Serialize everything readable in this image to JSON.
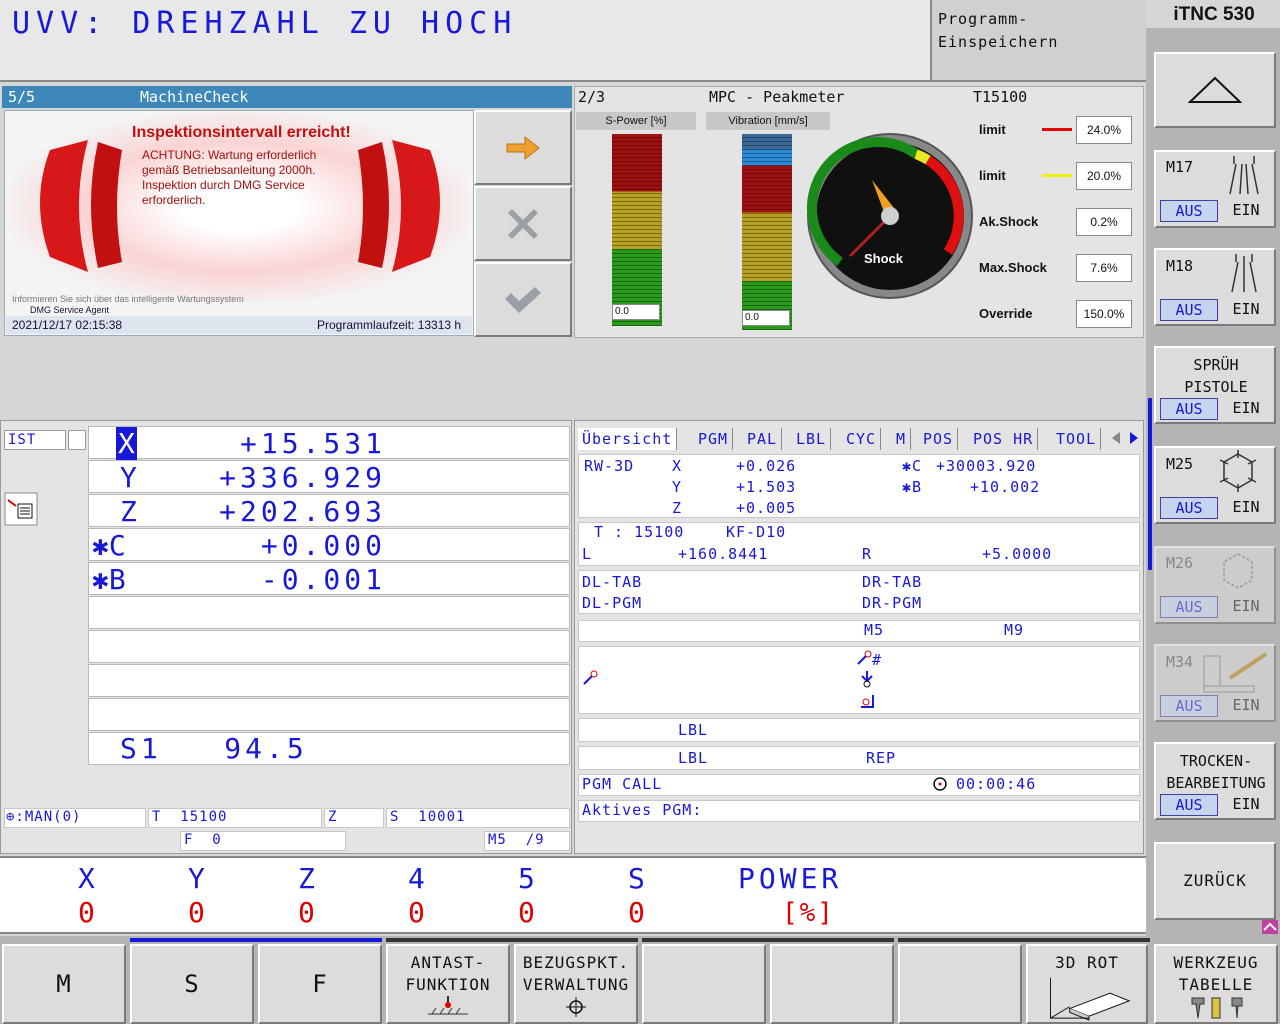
{
  "header": {
    "message": "UVV: DREHZAHL ZU HOCH",
    "mode_label": "Programm-\nEinspeichern",
    "brand": "iTNC 530"
  },
  "machinecheck": {
    "counter": "5/5",
    "title": "MachineCheck",
    "heading": "Inspektionsintervall erreicht!",
    "body": "ACHTUNG: Wartung erforderlich\ngemäß Betriebsanleitung 2000h.\nInspektion durch DMG Service\nerforderlich.",
    "footer_info": "Informieren Sie sich über das intelligente Wartungssystem",
    "footer_agent": "DMG Service Agent",
    "date": "2021/12/17 02:15:38",
    "runtime": "Programmlaufzeit: 13313 h"
  },
  "peakmeter": {
    "counter": "2/3",
    "title": "MPC - Peakmeter",
    "tool": "T15100",
    "spower_label": "S-Power [%]",
    "vibration_label": "Vibration [mm/s]",
    "spower_value": "0.0",
    "vibration_value": "0.0",
    "gauge_label": "Shock",
    "rows": [
      {
        "label": "limit",
        "value": "24.0%",
        "color": "#e00000"
      },
      {
        "label": "limit",
        "value": "20.0%",
        "color": "#f0f000"
      },
      {
        "label": "Ak.Shock",
        "value": "0.2%"
      },
      {
        "label": "Max.Shock",
        "value": "7.6%"
      },
      {
        "label": "Override",
        "value": "150.0%"
      }
    ]
  },
  "position": {
    "mode": "IST",
    "axes": [
      {
        "name": "X",
        "value": "+15.531"
      },
      {
        "name": "Y",
        "value": "+336.929"
      },
      {
        "name": "Z",
        "value": "+202.693"
      },
      {
        "name": "✱C",
        "value": "+0.000"
      },
      {
        "name": "✱B",
        "value": "-0.001"
      }
    ],
    "spindle": "S1   94.5",
    "status": {
      "man": "⊕:MAN(0)",
      "tool": "T  15100",
      "axis": "Z",
      "speed": "S  10001",
      "feed": "F  0",
      "mfunc": "M5  /9"
    }
  },
  "overview": {
    "tabs": [
      "Übersicht",
      "PGM",
      "PAL",
      "LBL",
      "CYC",
      "M",
      "POS",
      "POS HR",
      "TOOL"
    ],
    "rw3d": "RW-3D",
    "rw": [
      {
        "axis": "X",
        "value": "+0.026"
      },
      {
        "axis": "Y",
        "value": "+1.503"
      },
      {
        "axis": "Z",
        "value": "+0.005"
      }
    ],
    "rot": [
      {
        "axis": "✱C",
        "value": "+30003.920"
      },
      {
        "axis": "✱B",
        "value": "+10.002"
      }
    ],
    "tool_t": "T : 15100",
    "tool_name": "KF-D10",
    "l_label": "L",
    "l_value": "+160.8441",
    "r_label": "R",
    "r_value": "+5.0000",
    "dl_tab": "DL-TAB",
    "dr_tab": "DR-TAB",
    "dl_pgm": "DL-PGM",
    "dr_pgm": "DR-PGM",
    "m5": "M5",
    "m9": "M9",
    "hash": "#",
    "lbl1": "LBL",
    "lbl2": "LBL",
    "rep": "REP",
    "pgm_call": "PGM CALL",
    "time": "00:00:46",
    "active_pgm": "Aktives PGM:"
  },
  "load": {
    "axes": [
      "X",
      "Y",
      "Z",
      "4",
      "5",
      "S"
    ],
    "values": [
      "0",
      "0",
      "0",
      "0",
      "0",
      "0"
    ],
    "power_label": "POWER",
    "power_unit": "[%]"
  },
  "right_softkeys": {
    "m17": "M17",
    "m18": "M18",
    "spray": "SPRÜH\nPISTOLE",
    "m25": "M25",
    "m26": "M26",
    "m34": "M34",
    "dry": "TROCKEN-\nBEARBEITUNG",
    "back": "ZURÜCK",
    "aus": "AUS",
    "ein": "EIN"
  },
  "bottom_softkeys": {
    "m": "M",
    "s": "S",
    "f": "F",
    "probe": "ANTAST-\nFUNKTION",
    "datum": "BEZUGSPKT.\nVERWALTUNG",
    "rot3d": "3D ROT",
    "tooltable": "WERKZEUG\nTABELLE"
  }
}
